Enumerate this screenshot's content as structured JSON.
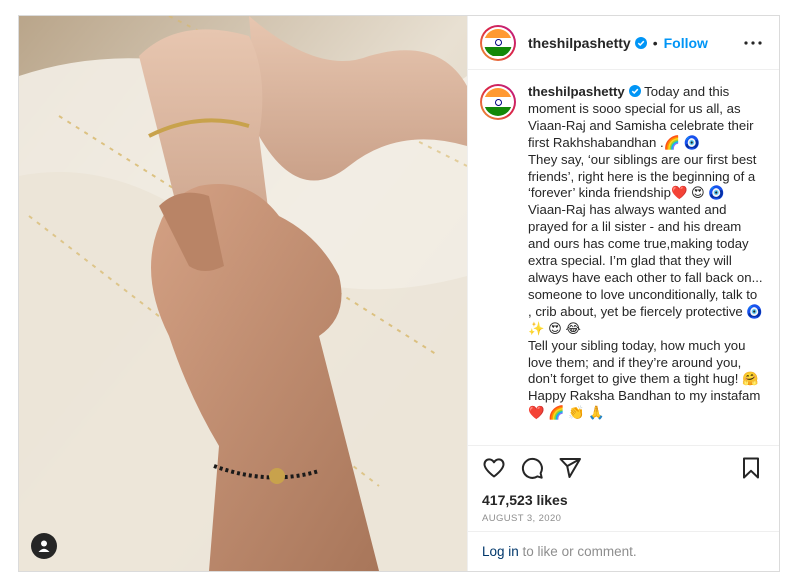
{
  "post": {
    "username": "theshilpashetty",
    "follow_label": "Follow",
    "separator": "•",
    "caption": {
      "username": "theshilpashetty",
      "text": "Today and this moment is sooo special for us all, as Viaan-Raj and Samisha celebrate their first Rakhshabandhan .🌈 🧿\nThey say, ‘our siblings are our first best friends’, right here is the beginning of a ‘forever’ kinda friendship❤️ 😍 🧿 Viaan-Raj has always wanted and prayed for a lil sister - and his dream and ours has come true,making today extra special. I’m glad that they will always have each other to fall back on... someone to love unconditionally, talk to , crib about, yet be fiercely protective 🧿 ✨ 😍 😂\nTell your sibling today, how much you love them; and if they’re around you, don’t forget to give them a tight hug! 🤗\nHappy Raksha Bandhan to my instafam❤️ 🌈 👏 🙏"
    },
    "likes": "417,523 likes",
    "date": "AUGUST 3, 2020",
    "comment_bar": {
      "login_label": "Log in",
      "rest": " to like or comment."
    }
  },
  "colors": {
    "accent": "#0095f6",
    "link": "#00376b",
    "muted": "#8e8e8e",
    "border": "#dbdbdb"
  },
  "icons": [
    "verified-badge-icon",
    "more-options-icon",
    "heart-icon",
    "comment-icon",
    "share-icon",
    "bookmark-icon",
    "user-tag-icon"
  ]
}
